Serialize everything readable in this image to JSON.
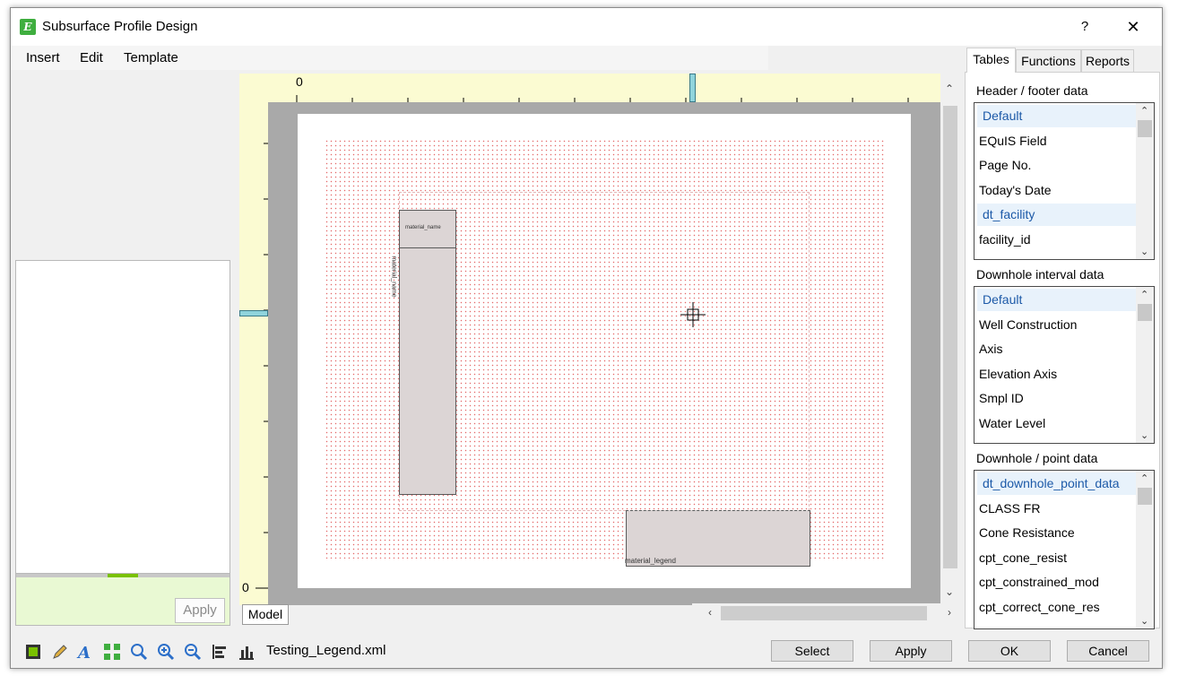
{
  "window": {
    "title": "Subsurface Profile Design",
    "help_label": "?",
    "close_label": "✕",
    "app_icon_letter": "E"
  },
  "menu": {
    "items": [
      "Insert",
      "Edit",
      "Template"
    ]
  },
  "left_panel": {
    "apply_label": "Apply"
  },
  "canvas": {
    "ruler_top_zero": "0",
    "ruler_left_zero": "0",
    "column_header_text": "material_name",
    "column_vertical_text": "material_name",
    "legend_text": "material_legend",
    "dot_color": "#e46a6a",
    "model_tab": "Model"
  },
  "right_panel": {
    "tabs": [
      "Tables",
      "Functions",
      "Reports"
    ],
    "active_tab": "Tables",
    "sections": [
      {
        "title": "Header / footer data",
        "items": [
          "Default",
          "EQuIS Field",
          "Page No.",
          "Today's Date",
          "dt_facility",
          "facility_id"
        ],
        "selected": [
          0,
          4
        ]
      },
      {
        "title": "Downhole interval data",
        "items": [
          "Default",
          "Well Construction",
          "Axis",
          "Elevation Axis",
          "Smpl ID",
          "Water Level"
        ],
        "selected": [
          0
        ]
      },
      {
        "title": "Downhole / point data",
        "items": [
          "dt_downhole_point_data",
          "CLASS FR",
          "Cone Resistance",
          "cpt_cone_resist",
          "cpt_constrained_mod",
          "cpt_correct_cone_res"
        ],
        "selected": [
          0
        ]
      }
    ]
  },
  "toolbar": {
    "icons": [
      "select-rect-icon",
      "pencil-icon",
      "text-tool-icon",
      "fit-page-icon",
      "zoom-icon",
      "zoom-in-icon",
      "zoom-out-icon",
      "align-icon",
      "chart-icon"
    ],
    "filename": "Testing_Legend.xml",
    "buttons": {
      "select": "Select",
      "apply": "Apply",
      "ok": "OK",
      "cancel": "Cancel"
    }
  },
  "colors": {
    "accent_green": "#7ac100",
    "ruler_yellow": "#fbfbd2",
    "selection_blue": "#1d5aa8"
  }
}
